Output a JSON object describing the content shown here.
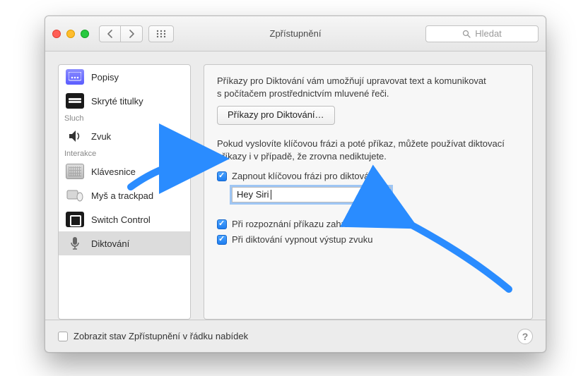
{
  "window": {
    "title": "Zpřístupnění",
    "search_placeholder": "Hledat"
  },
  "sidebar": {
    "items": [
      {
        "label": "Popisy"
      },
      {
        "label": "Skryté titulky"
      }
    ],
    "section_sluch": "Sluch",
    "items_sluch": [
      {
        "label": "Zvuk"
      }
    ],
    "section_interakce": "Interakce",
    "items_inter": [
      {
        "label": "Klávesnice"
      },
      {
        "label": "Myš a trackpad"
      },
      {
        "label": "Switch Control"
      },
      {
        "label": "Diktování"
      }
    ]
  },
  "main": {
    "intro": "Příkazy pro Diktování vám umožňují upravovat text a komunikovat s počítačem prostřednictvím mluvené řeči.",
    "btn_commands": "Příkazy pro Diktování…",
    "phrase_info": "Pokud vyslovíte klíčovou frázi a poté příkaz, můžete používat diktovací příkazy i v případě, že zrovna nediktujete.",
    "chk_enable_phrase": "Zapnout klíčovou frázi pro diktování:",
    "phrase_value": "Hey Siri",
    "chk_play_sound": "Při rozpoznání příkazu zahrát zvuk",
    "chk_mute_output": "Při diktování vypnout výstup zvuku"
  },
  "footer": {
    "show_status": "Zobrazit stav Zpřístupnění v řádku nabídek"
  }
}
